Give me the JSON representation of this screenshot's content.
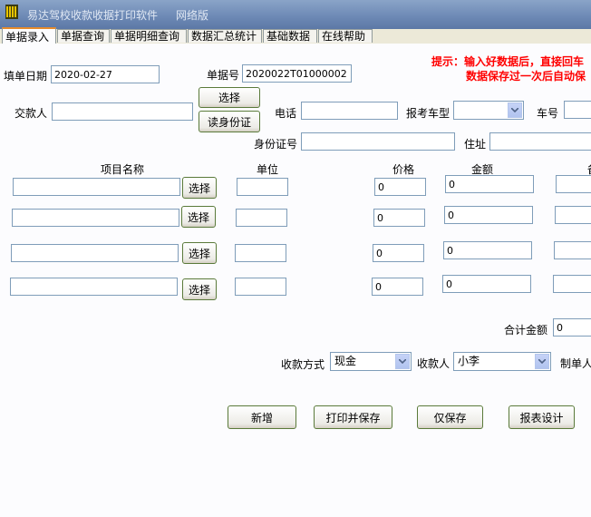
{
  "window": {
    "title": "易达驾校收款收据打印软件",
    "subtitle": "网络版"
  },
  "tabs": [
    {
      "label": "单据录入"
    },
    {
      "label": "单据查询"
    },
    {
      "label": "单据明细查询"
    },
    {
      "label": "数据汇总统计"
    },
    {
      "label": "基础数据"
    },
    {
      "label": "在线帮助"
    }
  ],
  "hint": {
    "line1": "提示：输入好数据后，直接回车",
    "line2": "数据保存过一次后自动保"
  },
  "form": {
    "date_label": "填单日期",
    "date_value": "2020-02-27",
    "docno_label": "单据号",
    "docno_value": "2020022T01000002",
    "payer_label": "交款人",
    "payer_value": "",
    "select_label": "选择",
    "read_id_label": "读身份证",
    "phone_label": "电话",
    "phone_value": "",
    "cartype_label": "报考车型",
    "cartype_value": "",
    "carno_label": "车号",
    "carno_value": "",
    "idno_label": "身份证号",
    "idno_value": "",
    "address_label": "住址",
    "address_value": ""
  },
  "items": {
    "headers": {
      "name": "项目名称",
      "unit": "单位",
      "price": "价格",
      "amount": "金额",
      "extra": "备"
    },
    "select_label": "选择",
    "rows": [
      {
        "name": "",
        "unit": "",
        "price": "0",
        "amount": "0"
      },
      {
        "name": "",
        "unit": "",
        "price": "0",
        "amount": "0"
      },
      {
        "name": "",
        "unit": "",
        "price": "0",
        "amount": "0"
      },
      {
        "name": "",
        "unit": "",
        "price": "0",
        "amount": "0"
      }
    ]
  },
  "total": {
    "label": "合计金额",
    "value": "0"
  },
  "payment": {
    "method_label": "收款方式",
    "method_value": "现金",
    "payee_label": "收款人",
    "payee_value": "小李",
    "maker_label": "制单人"
  },
  "actions": {
    "new": "新增",
    "print_save": "打印并保存",
    "save_only": "仅保存",
    "report_design": "报表设计"
  }
}
